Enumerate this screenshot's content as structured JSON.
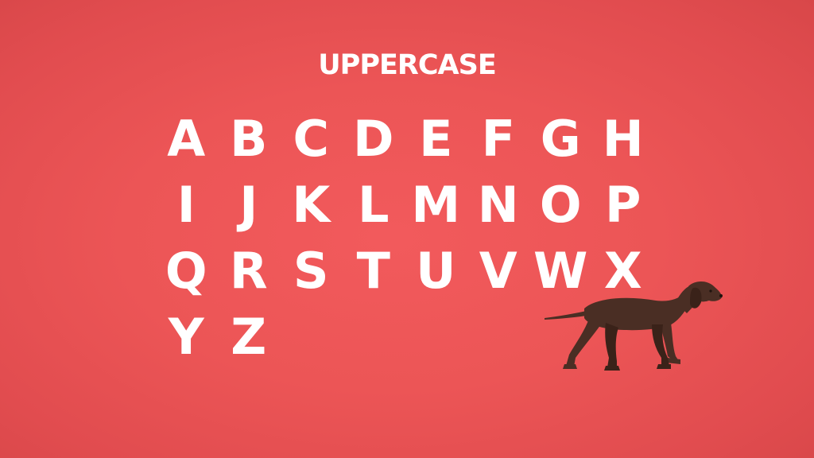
{
  "title": "UPPERCASE",
  "letters": [
    "A",
    "B",
    "C",
    "D",
    "E",
    "F",
    "G",
    "H",
    "I",
    "J",
    "K",
    "L",
    "M",
    "N",
    "O",
    "P",
    "Q",
    "R",
    "S",
    "T",
    "U",
    "V",
    "W",
    "X",
    "Y",
    "Z"
  ],
  "colors": {
    "background": "#ec5556",
    "text": "#ffffff",
    "dog": "#4a2e24"
  },
  "illustration": "walking-dog-icon"
}
